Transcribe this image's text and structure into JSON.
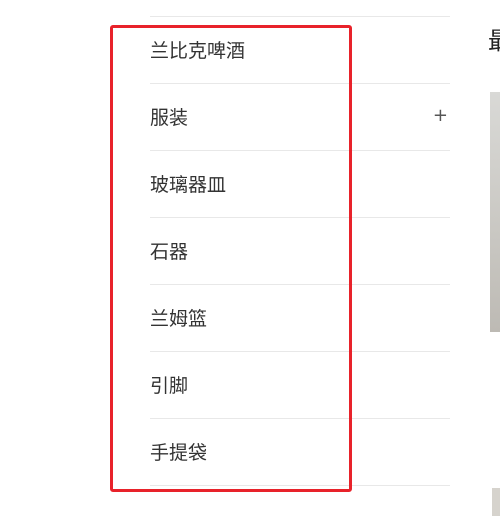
{
  "menu": {
    "items": [
      {
        "label": "兰比克啤酒",
        "expandable": false
      },
      {
        "label": "服装",
        "expandable": true,
        "expand_symbol": "+"
      },
      {
        "label": "玻璃器皿",
        "expandable": false
      },
      {
        "label": "石器",
        "expandable": false
      },
      {
        "label": "兰姆篮",
        "expandable": false
      },
      {
        "label": "引脚",
        "expandable": false
      },
      {
        "label": "手提袋",
        "expandable": false
      }
    ]
  },
  "right_panel": {
    "heading": "最"
  },
  "colors": {
    "highlight": "#e8222a",
    "divider": "#e8e8e8",
    "text": "#333333"
  }
}
